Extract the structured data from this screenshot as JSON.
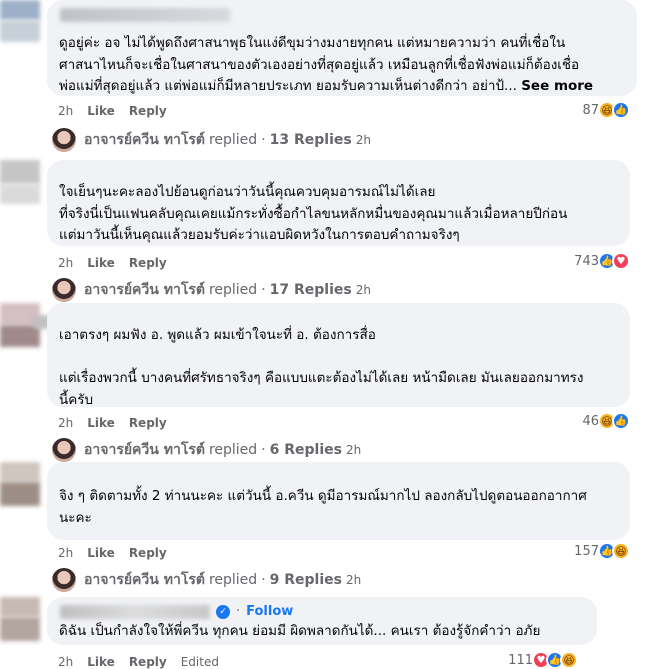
{
  "comments": [
    {
      "text": "ดูอยู่ค่ะ อจ ไม่ได้พูดถึงศาสนาพุธในแง่ดีขุมว่างมงายทุกคน แต่หมายความว่า คนที่เชื่อใน\nศาสนาไหนก็จะเชื่อในศาสนาของตัวเองอย่างที่สุดอยู่แล้ว เหมือนลูกที่เชื่อฟังพ่อแม่ก็ต้องเชื่อ\nพ่อแม่ที่สุดอยู่แล้ว แต่พ่อแม่ก็มีหลายประเภท ยอมรับความเห็นต่างดีกว่า อย่าป้...",
      "see_more": "See more",
      "time": "2h",
      "like": "Like",
      "reply": "Reply",
      "reaction_count": "87",
      "reactions": [
        "haha",
        "like"
      ],
      "reply_author": "อาจารย์ควีน ทาโรต์",
      "reply_verb": "replied",
      "reply_dot": "·",
      "replies": "13 Replies",
      "reply_time": "2h"
    },
    {
      "text": "ใจเย็นๆนะคะลองไปย้อนดูก่อนว่าวันนี้คุณควบคุมอารมณ์ไม่ได้เลย\nที่จริงนี่เป็นแฟนคลับคุณเคยแม้กระทั่งซื้อกำไลขนหลักหมื่นของคุณมาแล้วเมื่อหลายปีก่อน\nแต่มาวันนี้เห็นคุณแล้วยอมรับค่ะว่าแอบผิดหวังในการตอบคำถามจริงๆ",
      "time": "2h",
      "like": "Like",
      "reply": "Reply",
      "reaction_count": "743",
      "reactions": [
        "like",
        "love"
      ],
      "reply_author": "อาจารย์ควีน ทาโรต์",
      "reply_verb": "replied",
      "reply_dot": "·",
      "replies": "17 Replies",
      "reply_time": "2h"
    },
    {
      "text": "เอาตรงๆ ผมฟัง อ. พูดแล้ว ผมเข้าใจนะที่ อ. ต้องการสื่อ\n\nแต่เรื่องพวกนี้ บางคนที่ศรัทธาจริงๆ คือแบบแตะต้องไม่ได้เลย หน้ามืดเลย มันเลยออกมาทรง\nนี้ครับ",
      "time": "2h",
      "like": "Like",
      "reply": "Reply",
      "reaction_count": "46",
      "reactions": [
        "haha",
        "like"
      ],
      "reply_author": "อาจารย์ควีน ทาโรต์",
      "reply_verb": "replied",
      "reply_dot": "·",
      "replies": "6 Replies",
      "reply_time": "2h"
    },
    {
      "text": "จิง ๆ ติดตามทั้ง 2 ท่านนะคะ แต่วันนี้ อ.ควีน ดูมีอารมณ์มากไป ลองกลับไปดูตอนออกอากาศ\nนะคะ",
      "time": "2h",
      "like": "Like",
      "reply": "Reply",
      "reaction_count": "157",
      "reactions": [
        "like",
        "haha"
      ],
      "reply_author": "อาจารย์ควีน ทาโรต์",
      "reply_verb": "replied",
      "reply_dot": "·",
      "replies": "9 Replies",
      "reply_time": "2h"
    },
    {
      "follow": "Follow",
      "follow_dot": "·",
      "text": "ดิฉัน เป็นกำลังใจให้พี่ควีน ทุกคน ย่อมมี ผิดพลาดกันได้... คนเรา ต้องรู้จักคำว่า อภัย",
      "time": "2h",
      "like": "Like",
      "reply": "Reply",
      "edited": "Edited",
      "reaction_count": "111",
      "reactions": [
        "love",
        "like",
        "haha"
      ]
    }
  ],
  "icons": {
    "like": "thumbs-up-icon",
    "love": "heart-icon",
    "haha": "laugh-icon",
    "verified": "verified-badge-icon"
  },
  "colors": {
    "bubble": "#f0f2f5",
    "link": "#1877f2",
    "muted": "#65676b"
  }
}
